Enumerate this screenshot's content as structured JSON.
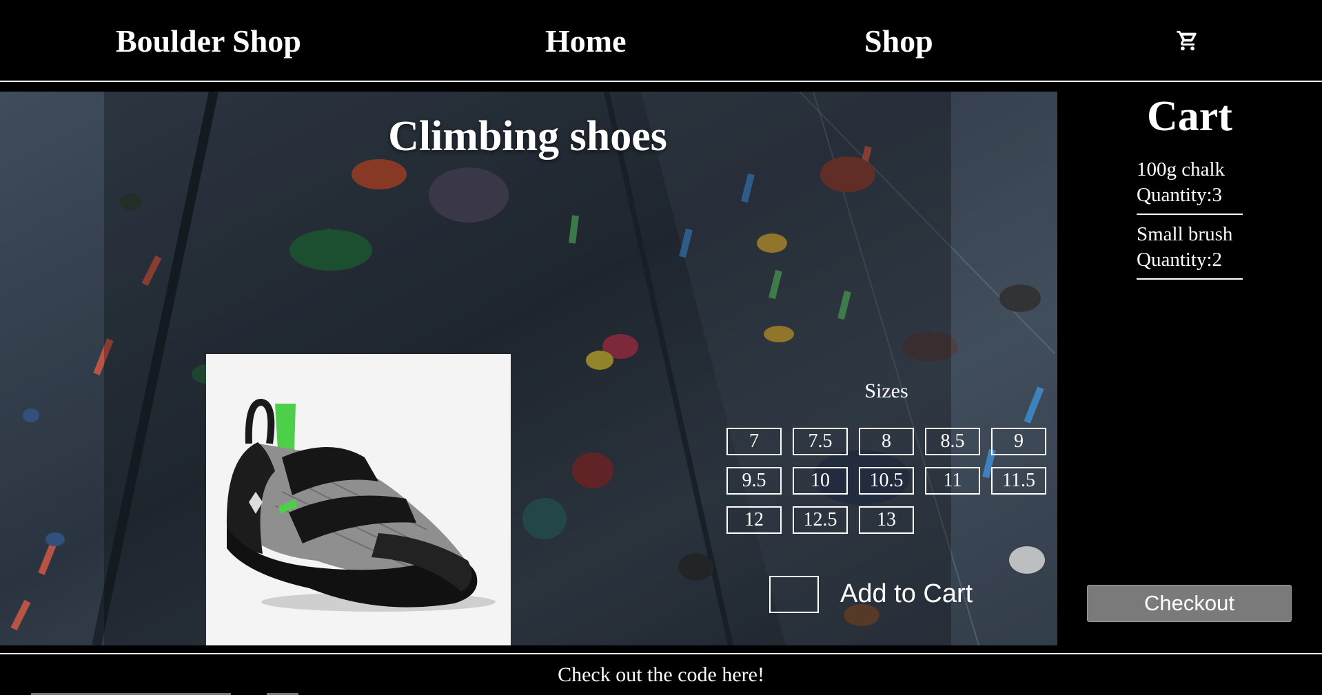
{
  "header": {
    "brand": "Boulder Shop",
    "nav": {
      "home": "Home",
      "shop": "Shop"
    },
    "cart_icon": "shopping-cart-icon"
  },
  "product": {
    "title": "Climbing shoes",
    "image": "climbing-shoe-image",
    "sizes_label": "Sizes",
    "sizes": [
      "7",
      "7.5",
      "8",
      "8.5",
      "9",
      "9.5",
      "10",
      "10.5",
      "11",
      "11.5",
      "12",
      "12.5",
      "13"
    ],
    "selected_size": "7",
    "quantity_value": "",
    "add_to_cart_label": "Add to Cart"
  },
  "cart": {
    "title": "Cart",
    "items": [
      {
        "name": "100g chalk",
        "quantity": "Quantity:3"
      },
      {
        "name": "Small brush",
        "quantity": "Quantity:2"
      }
    ],
    "checkout_label": "Checkout"
  },
  "footer": {
    "link_text": "Check out the code here!"
  },
  "colors": {
    "background": "#000000",
    "text": "#ffffff",
    "checkout_button": "#7a7a7a"
  }
}
